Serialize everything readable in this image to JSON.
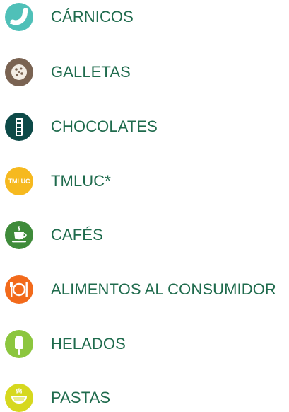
{
  "categories": [
    {
      "label": "CÁRNICOS",
      "icon": "sausage-icon",
      "color": "#4fc0b8"
    },
    {
      "label": "GALLETAS",
      "icon": "cookie-icon",
      "color": "#7a6352"
    },
    {
      "label": "CHOCOLATES",
      "icon": "chocolate-bar-icon",
      "color": "#0d4a48"
    },
    {
      "label": "TMLUC*",
      "icon": "tmluc-logo-icon",
      "color": "#f6b91f",
      "icon_text": "TMLUC"
    },
    {
      "label": "CAFÉS",
      "icon": "coffee-cup-icon",
      "color": "#3f8b3a"
    },
    {
      "label": "ALIMENTOS AL CONSUMIDOR",
      "icon": "plate-cutlery-icon",
      "color": "#f26a1b"
    },
    {
      "label": "HELADOS",
      "icon": "popsicle-icon",
      "color": "#8cc63e"
    },
    {
      "label": "PASTAS",
      "icon": "pasta-bowl-icon",
      "color": "#d6d81e"
    }
  ]
}
